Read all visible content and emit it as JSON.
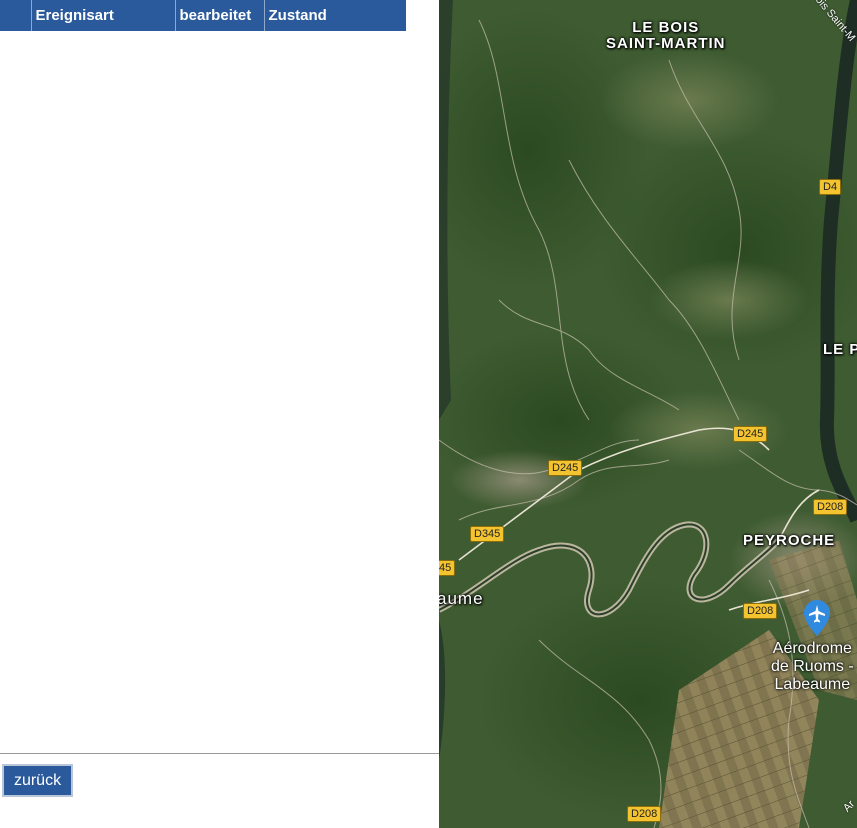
{
  "table": {
    "columns": [
      "",
      "Ereignisart",
      "bearbeitet",
      "Zustand"
    ]
  },
  "footer": {
    "back_label": "zurück"
  },
  "map": {
    "places": [
      {
        "name": "LE BOIS\nSAINT-MARTIN"
      },
      {
        "name": "PEYROCHE"
      },
      {
        "name": "LE P"
      },
      {
        "name": "aume"
      }
    ],
    "poi": {
      "name": "Aérodrome\nde Ruoms -\nLabeaume",
      "icon": "airport-icon"
    },
    "roads": [
      "D4",
      "D245",
      "D245",
      "D208",
      "D345",
      "D208",
      "D208",
      "45"
    ],
    "diagonal_label": "ois Saint-M",
    "corner_label": "Ar"
  },
  "colors": {
    "header_bg": "#2a5a9b",
    "header_text": "#ffffff",
    "road_shield": "#f4c430"
  }
}
